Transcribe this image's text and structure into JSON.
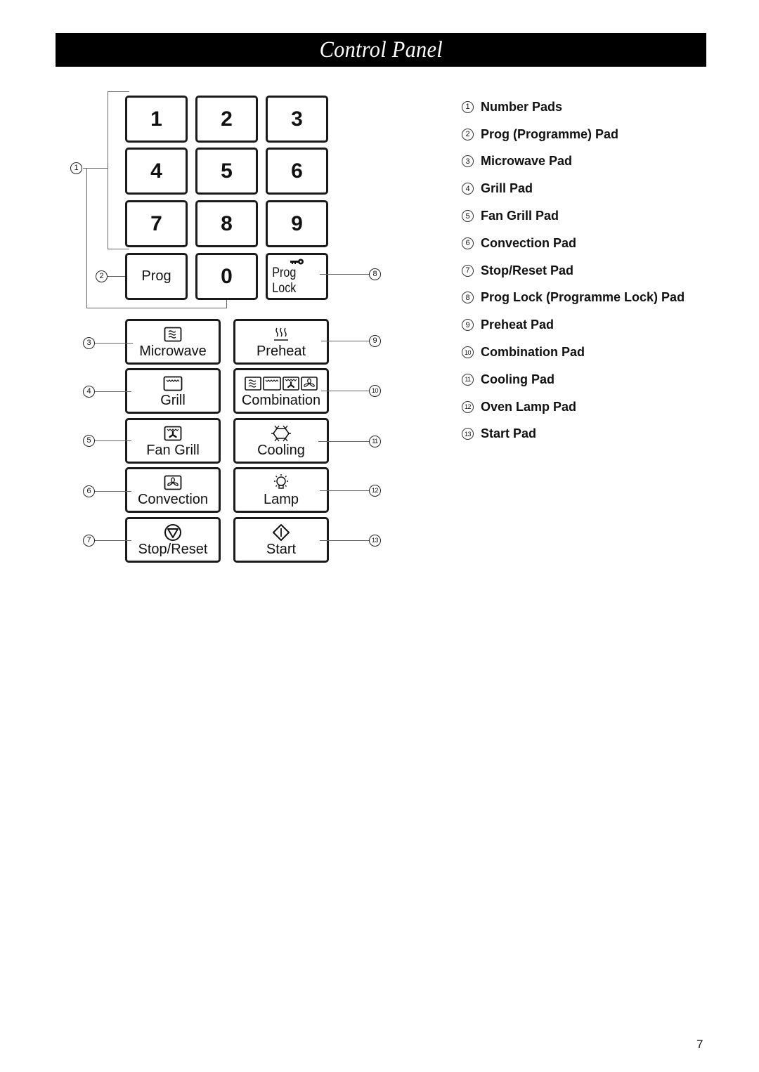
{
  "header": {
    "title": "Control Panel"
  },
  "number_pads": [
    {
      "label": "1"
    },
    {
      "label": "2"
    },
    {
      "label": "3"
    },
    {
      "label": "4"
    },
    {
      "label": "5"
    },
    {
      "label": "6"
    },
    {
      "label": "7"
    },
    {
      "label": "8"
    },
    {
      "label": "9"
    }
  ],
  "bottom_row": {
    "prog": "Prog",
    "zero": "0",
    "prog_lock": "Prog Lock",
    "prog_lock_icon": "key-icon"
  },
  "function_pads": [
    {
      "label": "Microwave",
      "icon": "microwave-icon",
      "callout": "3"
    },
    {
      "label": "Preheat",
      "icon": "preheat-icon",
      "callout": "9"
    },
    {
      "label": "Grill",
      "icon": "grill-icon",
      "callout": "4"
    },
    {
      "label": "Combination",
      "icon": "combination-icon",
      "callout": "10"
    },
    {
      "label": "Fan Grill",
      "icon": "fan-grill-icon",
      "callout": "5"
    },
    {
      "label": "Cooling",
      "icon": "snowflake-icon",
      "callout": "11"
    },
    {
      "label": "Convection",
      "icon": "fan-icon",
      "callout": "6"
    },
    {
      "label": "Lamp",
      "icon": "lamp-icon",
      "callout": "12"
    },
    {
      "label": "Stop/Reset",
      "icon": "stop-icon",
      "callout": "7"
    },
    {
      "label": "Start",
      "icon": "start-icon",
      "callout": "13"
    }
  ],
  "callouts": {
    "c1": "1",
    "c2": "2",
    "c3": "3",
    "c4": "4",
    "c5": "5",
    "c6": "6",
    "c7": "7",
    "c8": "8",
    "c9": "9",
    "c10": "10",
    "c11": "11",
    "c12": "12",
    "c13": "13"
  },
  "legend": [
    {
      "num": "1",
      "text": "Number Pads"
    },
    {
      "num": "2",
      "text": "Prog (Programme) Pad"
    },
    {
      "num": "3",
      "text": "Microwave Pad"
    },
    {
      "num": "4",
      "text": "Grill Pad"
    },
    {
      "num": "5",
      "text": "Fan Grill Pad"
    },
    {
      "num": "6",
      "text": "Convection Pad"
    },
    {
      "num": "7",
      "text": "Stop/Reset Pad"
    },
    {
      "num": "8",
      "text": "Prog Lock (Programme Lock) Pad"
    },
    {
      "num": "9",
      "text": "Preheat Pad"
    },
    {
      "num": "10",
      "text": "Combination Pad"
    },
    {
      "num": "11",
      "text": "Cooling Pad"
    },
    {
      "num": "12",
      "text": "Oven Lamp Pad"
    },
    {
      "num": "13",
      "text": "Start Pad"
    }
  ],
  "footer": {
    "page_number": "7"
  }
}
